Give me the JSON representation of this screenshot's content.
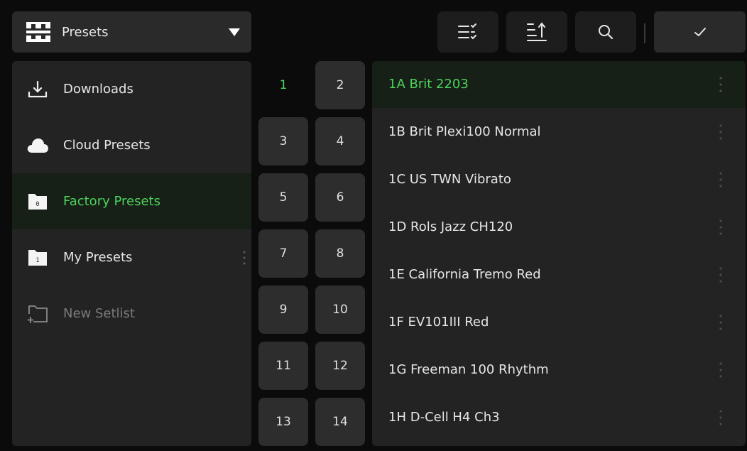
{
  "header": {
    "dropdown_label": "Presets",
    "dropdown_icon": "grid-icon",
    "toolbar": [
      {
        "name": "multi-select-button",
        "icon": "list-check-icon"
      },
      {
        "name": "sort-button",
        "icon": "sort-icon"
      },
      {
        "name": "search-button",
        "icon": "search-icon"
      }
    ],
    "confirm_icon": "checkmark-icon"
  },
  "sidebar": {
    "items": [
      {
        "label": "Downloads",
        "icon": "download-icon",
        "state": "normal"
      },
      {
        "label": "Cloud Presets",
        "icon": "cloud-icon",
        "state": "normal"
      },
      {
        "label": "Factory Presets",
        "icon": "folder-icon",
        "badge": "0",
        "state": "active"
      },
      {
        "label": "My Presets",
        "icon": "folder-icon",
        "badge": "1",
        "state": "normal"
      },
      {
        "label": "New Setlist",
        "icon": "new-folder-icon",
        "state": "disabled"
      }
    ]
  },
  "banks": [
    "1",
    "2",
    "3",
    "4",
    "5",
    "6",
    "7",
    "8",
    "9",
    "10",
    "11",
    "12",
    "13",
    "14"
  ],
  "selected_bank": "1",
  "presets": [
    "1A Brit 2203",
    "1B Brit Plexi100 Normal",
    "1C US TWN Vibrato",
    "1D Rols Jazz CH120",
    "1E California Tremo Red",
    "1F EV101III Red",
    "1G Freeman 100 Rhythm",
    "1H D-Cell H4 Ch3"
  ],
  "selected_preset": "1A Brit 2203",
  "colors": {
    "accent": "#4cd25c",
    "background": "#0b0b0b",
    "panel": "#232323",
    "button": "#2d2d2d",
    "active_row": "#172017"
  }
}
